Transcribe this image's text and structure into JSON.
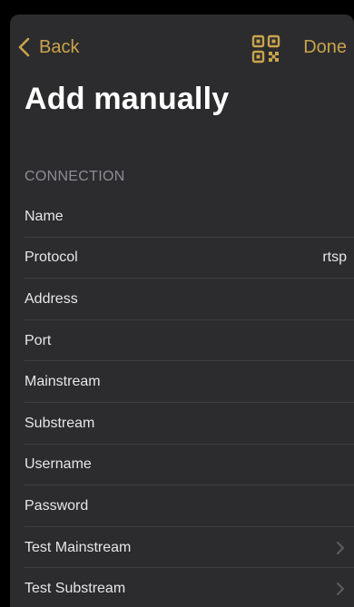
{
  "nav": {
    "back_label": "Back",
    "done_label": "Done",
    "accent_color": "#c9a44c",
    "qr_icon": "qr-code-icon"
  },
  "title": "Add manually",
  "section": {
    "header": "CONNECTION",
    "rows": [
      {
        "label": "Name",
        "value": ""
      },
      {
        "label": "Protocol",
        "value": "rtsp"
      },
      {
        "label": "Address",
        "value": ""
      },
      {
        "label": "Port",
        "value": ""
      },
      {
        "label": "Mainstream",
        "value": ""
      },
      {
        "label": "Substream",
        "value": ""
      },
      {
        "label": "Username",
        "value": ""
      },
      {
        "label": "Password",
        "value": ""
      },
      {
        "label": "Test Mainstream",
        "value": "",
        "chevron": true
      },
      {
        "label": "Test Substream",
        "value": "",
        "chevron": true
      }
    ]
  }
}
